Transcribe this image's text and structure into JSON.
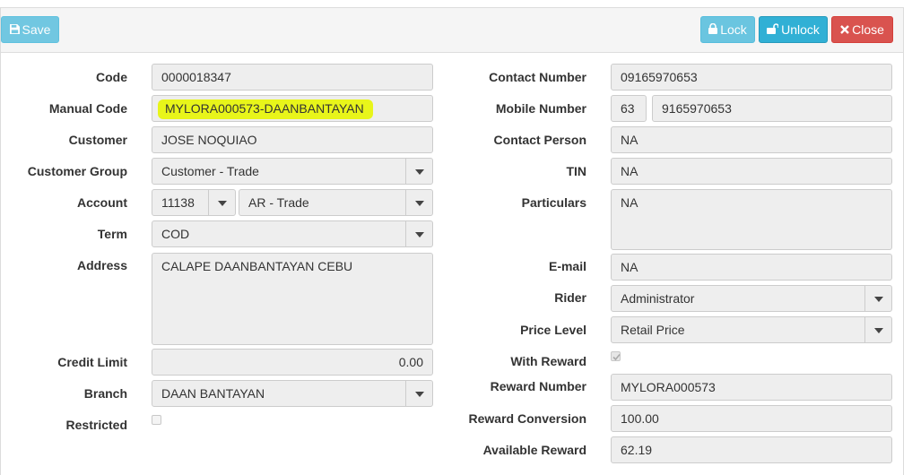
{
  "toolbar": {
    "save": "Save",
    "lock": "Lock",
    "unlock": "Unlock",
    "close": "Close"
  },
  "left": {
    "code": {
      "label": "Code",
      "value": "0000018347"
    },
    "manual_code": {
      "label": "Manual Code",
      "value": "MYLORA000573-DAANBANTAYAN"
    },
    "customer": {
      "label": "Customer",
      "value": "JOSE NOQUIAO"
    },
    "customer_group": {
      "label": "Customer Group",
      "value": "Customer - Trade"
    },
    "account": {
      "label": "Account",
      "code": "11138",
      "name": "AR - Trade"
    },
    "term": {
      "label": "Term",
      "value": "COD"
    },
    "address": {
      "label": "Address",
      "value": "CALAPE DAANBANTAYAN CEBU"
    },
    "credit_limit": {
      "label": "Credit Limit",
      "value": "0.00"
    },
    "branch": {
      "label": "Branch",
      "value": "DAAN BANTAYAN"
    },
    "restricted": {
      "label": "Restricted",
      "checked": false
    }
  },
  "right": {
    "contact_number": {
      "label": "Contact Number",
      "value": "09165970653"
    },
    "mobile_number": {
      "label": "Mobile Number",
      "prefix": "63",
      "value": "9165970653"
    },
    "contact_person": {
      "label": "Contact Person",
      "value": "NA"
    },
    "tin": {
      "label": "TIN",
      "value": "NA"
    },
    "particulars": {
      "label": "Particulars",
      "value": "NA"
    },
    "email": {
      "label": "E-mail",
      "value": "NA"
    },
    "rider": {
      "label": "Rider",
      "value": "Administrator"
    },
    "price_level": {
      "label": "Price Level",
      "value": "Retail Price"
    },
    "with_reward": {
      "label": "With Reward",
      "checked": true
    },
    "reward_number": {
      "label": "Reward Number",
      "value": "MYLORA000573"
    },
    "reward_conversion": {
      "label": "Reward Conversion",
      "value": "100.00"
    },
    "available_reward": {
      "label": "Available Reward",
      "value": "62.19"
    }
  },
  "colors": {
    "highlight": "#e8f51a",
    "info_button": "#5bc0de",
    "danger_button": "#d9534f"
  },
  "icons": {
    "save": "floppy-disk-icon",
    "lock": "lock-icon",
    "unlock": "unlock-icon",
    "close": "close-icon"
  }
}
